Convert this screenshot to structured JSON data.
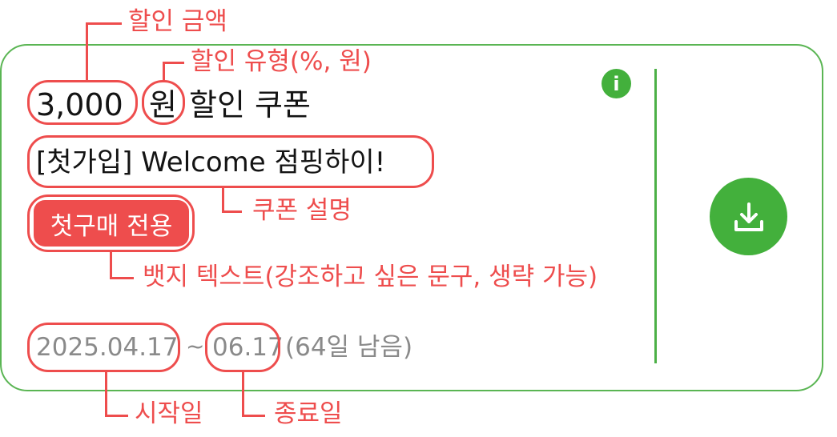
{
  "coupon": {
    "amount": "3,000",
    "unit": "원",
    "suffix": "할인 쿠폰",
    "description": "[첫가입] Welcome 점핑하이!",
    "badge": "첫구매 전용",
    "start_date": "2025.04.17",
    "separator": "~",
    "end_date": "06.17",
    "remaining": "(64일 남음)"
  },
  "annotations": {
    "amount": "할인 금액",
    "type": "할인 유형(%, 원)",
    "description": "쿠폰 설명",
    "badge": "뱃지 텍스트(강조하고 싶은 문구, 생략 가능)",
    "start": "시작일",
    "end": "종료일"
  },
  "icons": {
    "info": "info-icon",
    "download": "download-icon"
  },
  "colors": {
    "accent_green": "#43b03c",
    "annotation_red": "#ee4d4d",
    "badge_red": "#ee4d4d",
    "date_grey": "#8a8a8a"
  }
}
